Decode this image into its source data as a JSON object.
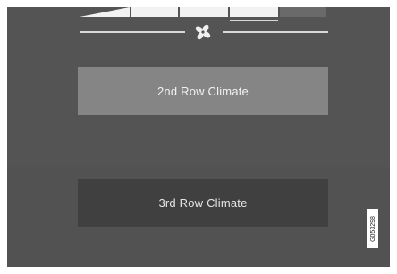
{
  "fan": {
    "icon": "fan-icon",
    "level": 3,
    "levels": 4
  },
  "buttons": {
    "second_row": "2nd Row Climate",
    "third_row": "3rd Row Climate"
  },
  "reference_code": "G053298",
  "colors": {
    "screen_bg": "#545454",
    "button_active": "#858585",
    "button_inactive": "#404040",
    "fan_on": "#f2f2f2",
    "fan_off": "#6a6a6a"
  }
}
